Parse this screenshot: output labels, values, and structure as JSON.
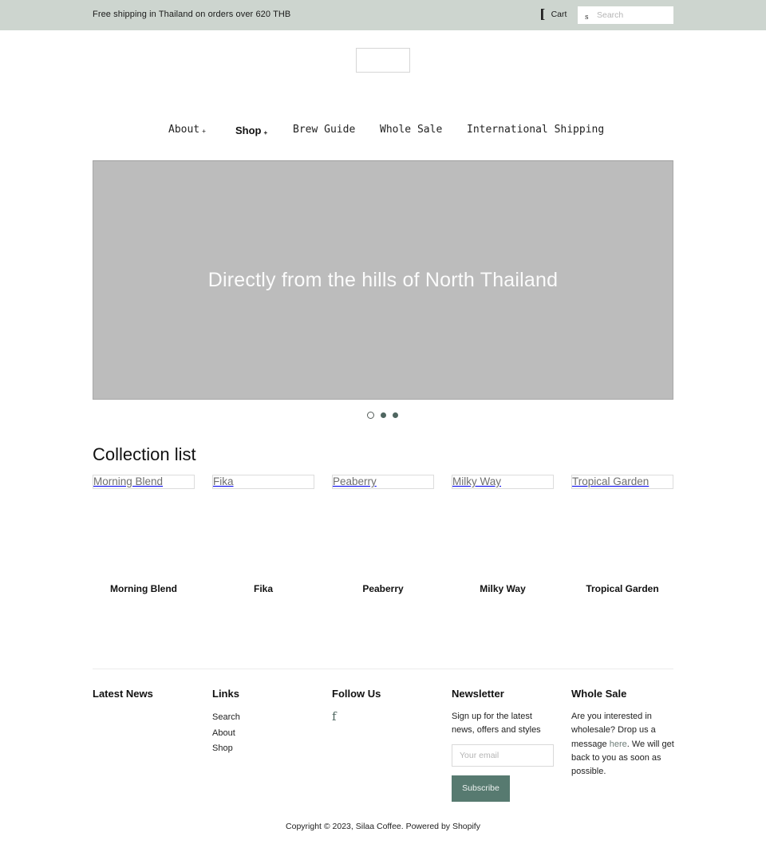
{
  "announcement": {
    "text": "Free shipping in Thailand on orders over 620 THB"
  },
  "header": {
    "cart_label": "Cart",
    "cart_icon": "[",
    "search_icon": "s",
    "search_placeholder": "Search",
    "search_value": ""
  },
  "nav": {
    "items": [
      {
        "label": "About",
        "has_dropdown": true,
        "caret": "+"
      },
      {
        "label": "Shop",
        "has_dropdown": true,
        "caret": "+",
        "active": true
      },
      {
        "label": "Brew Guide"
      },
      {
        "label": "Whole Sale"
      },
      {
        "label": "International Shipping"
      }
    ]
  },
  "hero": {
    "caption": "Directly from the hills of North Thailand",
    "slide_count": 3,
    "active_slide": 1
  },
  "collections": {
    "title": "Collection list",
    "items": [
      {
        "image_alt": "Morning Blend",
        "title": "Morning Blend"
      },
      {
        "image_alt": "Fika",
        "title": "Fika"
      },
      {
        "image_alt": "Peaberry",
        "title": "Peaberry"
      },
      {
        "image_alt": "Milky Way",
        "title": "Milky Way"
      },
      {
        "image_alt": "Tropical Garden",
        "title": "Tropical Garden"
      }
    ]
  },
  "footer": {
    "latest_news": {
      "title": "Latest News"
    },
    "links": {
      "title": "Links",
      "items": [
        "Search",
        "About",
        "Shop"
      ]
    },
    "follow": {
      "title": "Follow Us",
      "facebook_glyph": "f"
    },
    "newsletter": {
      "title": "Newsletter",
      "text": "Sign up for the latest news, offers and styles",
      "email_placeholder": "Your email",
      "email_value": "",
      "button_label": "Subscribe"
    },
    "wholesale": {
      "title": "Whole Sale",
      "text_before": "Are you interested in wholesale? Drop us a message ",
      "link_label": "here",
      "text_after": ". We will get back to you as soon as possible."
    },
    "copyright": "Copyright © 2023, Silaa Coffee. Powered by Shopify"
  },
  "colors": {
    "topbar_bg": "#cdd5cf",
    "accent": "#577a70",
    "hero_bg": "#bcbcbc"
  }
}
